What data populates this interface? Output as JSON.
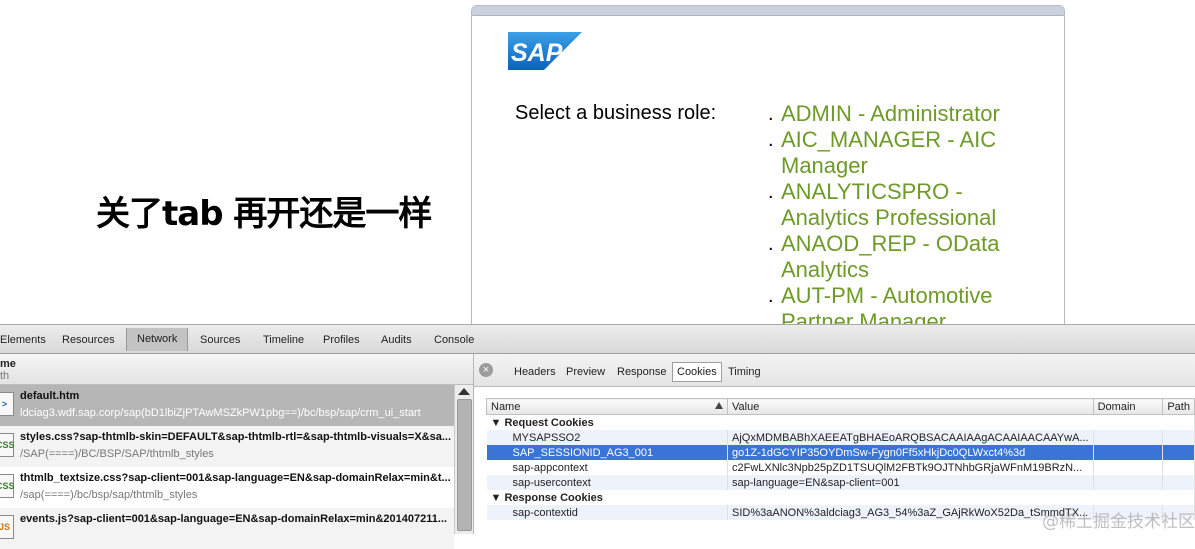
{
  "annotation_text": "关了tab 再开还是一样",
  "sap_page": {
    "logo_text": "SAP",
    "role_label": "Select a business role:",
    "roles": [
      "ADMIN - Administrator",
      "AIC_MANAGER - AIC Manager",
      "ANALYTICSPRO - Analytics Professional",
      "ANAOD_REP - OData Analytics",
      "AUT-PM - Automotive Partner Manager"
    ],
    "bullet": "."
  },
  "devtools": {
    "tabs": [
      "Elements",
      "Resources",
      "Network",
      "Sources",
      "Timeline",
      "Profiles",
      "Audits",
      "Console"
    ],
    "active_tab": "Network",
    "left_header": {
      "name": "me",
      "path": "th"
    },
    "requests": [
      {
        "name": "default.htm",
        "path": "ldciag3.wdf.sap.corp/sap(bD1lbiZjPTAwMSZkPW1pbg==)/bc/bsp/sap/crm_ui_start",
        "icon": ">"
      },
      {
        "name": "styles.css?sap-thtmlb-skin=DEFAULT&sap-thtmlb-rtl=&sap-thtmlb-visuals=X&sa...",
        "path": "/SAP(====)/BC/BSP/SAP/thtmlb_styles",
        "icon": "CSS"
      },
      {
        "name": "thtmlb_textsize.css?sap-client=001&sap-language=EN&sap-domainRelax=min&t...",
        "path": "/sap(====)/bc/bsp/sap/thtmlb_styles",
        "icon": "CSS"
      },
      {
        "name": "events.js?sap-client=001&sap-language=EN&sap-domainRelax=min&201407211...",
        "path": "",
        "icon": "JS"
      }
    ],
    "detail_tabs": [
      "Headers",
      "Preview",
      "Response",
      "Cookies",
      "Timing"
    ],
    "active_detail_tab": "Cookies",
    "cookie_columns": [
      "Name",
      "Value",
      "Domain",
      "Path"
    ],
    "request_cookies_label": "Request Cookies",
    "response_cookies_label": "Response Cookies",
    "request_cookies": [
      {
        "name": "MYSAPSSO2",
        "value": "AjQxMDMBABhXAEEATgBHAEoARQBSACAAIAAgACAAIAACAAYwA..."
      },
      {
        "name": "SAP_SESSIONID_AG3_001",
        "value": "go1Z-1dGCYIP35OYDmSw-Fygn0Ff5xHkjDc0QLWxct4%3d"
      },
      {
        "name": "sap-appcontext",
        "value": "c2FwLXNlc3Npb25pZD1TSUQlM2FBTk9OJTNhbGRjaWFnM19BRzN..."
      },
      {
        "name": "sap-usercontext",
        "value": "sap-language=EN&sap-client=001"
      }
    ],
    "response_cookies": [
      {
        "name": "sap-contextid",
        "value": "SID%3aANON%3aldciag3_AG3_54%3aZ_GAjRkWoX52Da_tSmmdTX..."
      }
    ],
    "selected_cookie": "SAP_SESSIONID_AG3_001"
  },
  "watermark": "@稀土掘金技术社区",
  "colors": {
    "role_link": "#6e9a28",
    "selection": "#3a75d6",
    "sap_blue": "#0a6ed1"
  }
}
